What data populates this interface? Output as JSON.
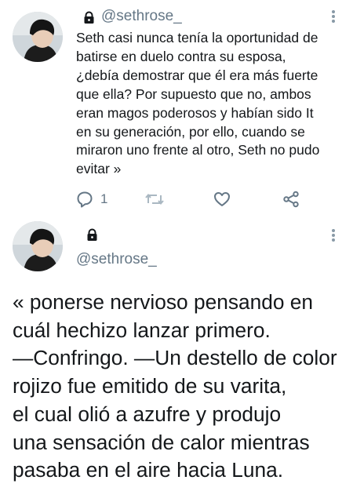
{
  "tweet1": {
    "handle": "@sethrose_",
    "body": "Seth casi nunca tenía la oportunidad de\nbatirse en duelo contra su esposa,\n¿debía demostrar que él era más fuerte\nque ella? Por supuesto que no, ambos\neran magos poderosos y habían sido It\nen su generación, por ello, cuando se\nmiraron uno frente al otro, Seth no pudo\nevitar »",
    "reply_count": "1",
    "icons": [
      "lock-icon",
      "more-icon",
      "reply-icon",
      "retweet-icon",
      "like-icon",
      "share-icon"
    ]
  },
  "tweet2": {
    "handle": "@sethrose_",
    "body": "« ponerse nervioso pensando en\ncuál hechizo lanzar primero.\n—Confringo. —Un destello de color\nrojizo fue emitido de su varita,\nel cual olió a azufre y produjo\nuna sensación de calor mientras\npasaba en el aire hacia Luna.",
    "icons": [
      "lock-icon",
      "more-icon"
    ]
  },
  "colors": {
    "text": "#14171a",
    "secondary": "#657786",
    "icon": "#8899a6"
  }
}
